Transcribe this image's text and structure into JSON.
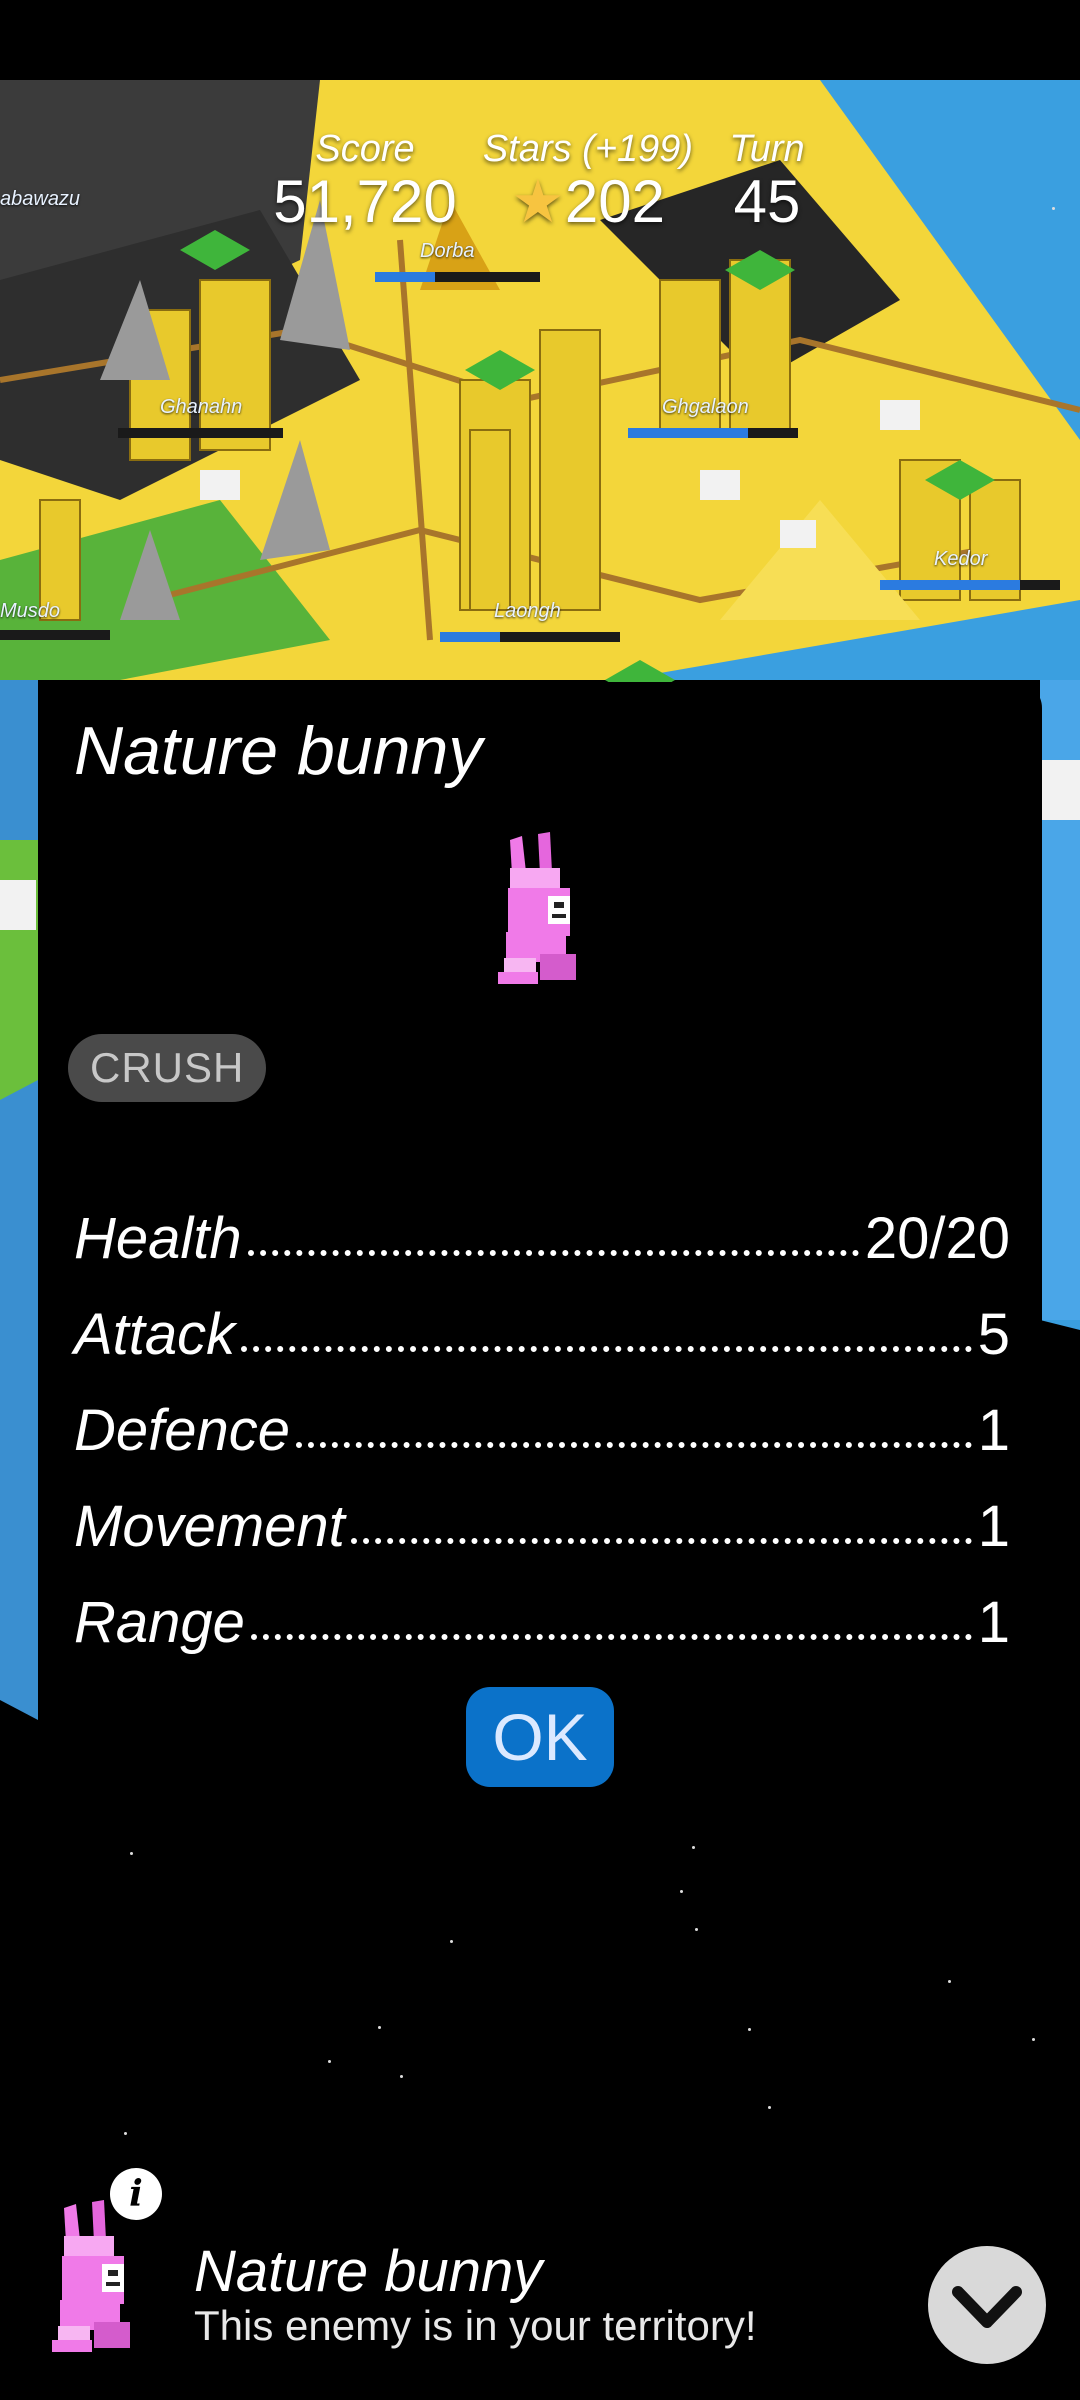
{
  "hud": {
    "score_label": "Score",
    "score_value": "51,720",
    "stars_label": "Stars (+199)",
    "stars_value": "202",
    "turn_label": "Turn",
    "turn_value": "45"
  },
  "map": {
    "cities": [
      "Dorba",
      "Ghanahn",
      "Ghgalaon",
      "Kedor",
      "Laongh",
      "Musdo",
      "abawazu"
    ]
  },
  "dialog": {
    "title": "Nature bunny",
    "skill": "CRUSH",
    "stats": [
      {
        "name": "Health",
        "value": "20/20"
      },
      {
        "name": "Attack",
        "value": "5"
      },
      {
        "name": "Defence",
        "value": "1"
      },
      {
        "name": "Movement",
        "value": "1"
      },
      {
        "name": "Range",
        "value": "1"
      }
    ],
    "ok_label": "OK"
  },
  "notification": {
    "info_glyph": "i",
    "title": "Nature bunny",
    "subtitle": "This enemy is in your territory!"
  },
  "colors": {
    "accent_blue": "#0b72c9",
    "bunny_pink": "#f07ae8",
    "star_gold": "#f7c440"
  }
}
